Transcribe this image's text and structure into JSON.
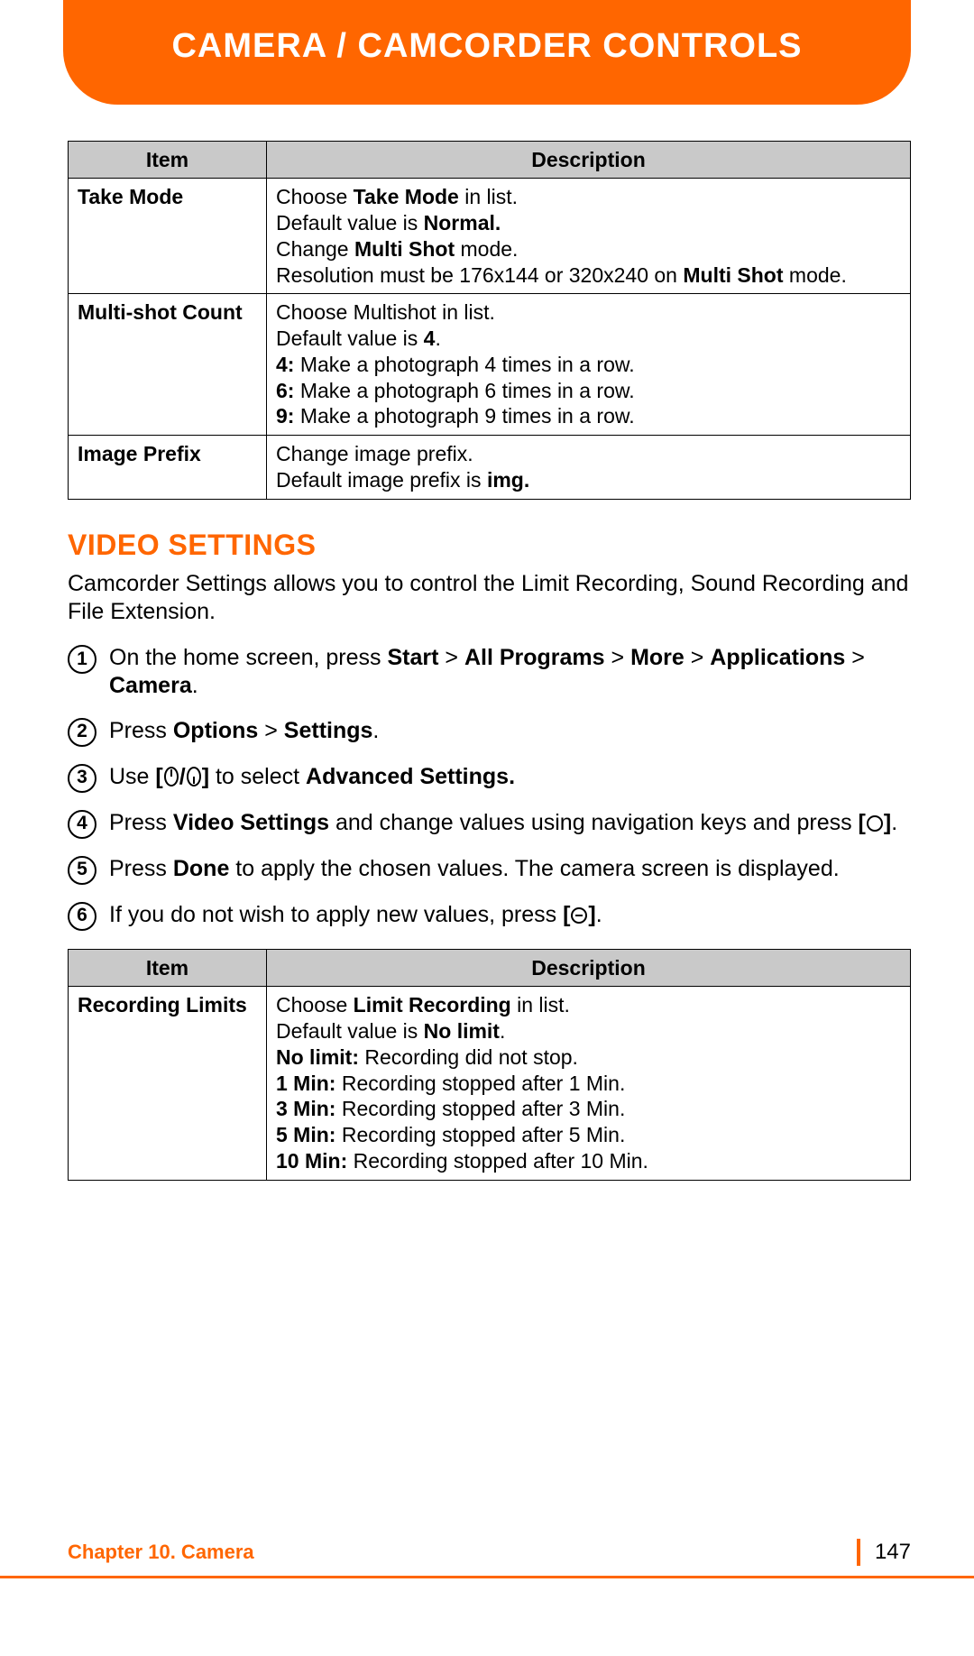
{
  "header": {
    "title": "CAMERA / CAMCORDER CONTROLS"
  },
  "table1": {
    "head_item": "Item",
    "head_desc": "Description",
    "rows": [
      {
        "item": "Take Mode",
        "desc_html": "Choose <b>Take Mode</b> in list.<br>Default value is <b>Normal.</b><br>Change <b>Multi Shot</b> mode.<br>Resolution must be 176x144 or 320x240 on <b>Multi Shot</b> mode."
      },
      {
        "item": "Multi-shot Count",
        "desc_html": "Choose Multishot in list.<br>Default value is <b>4</b>.<br><b>4:</b> Make a photograph 4 times in a row.<br><b>6:</b> Make a photograph 6 times in a row.<br><b>9:</b> Make a photograph 9 times in a row."
      },
      {
        "item": "Image Prefix",
        "desc_html": "Change image prefix.<br>Default image prefix is <b>img.</b>"
      }
    ]
  },
  "section": {
    "title": "VIDEO SETTINGS",
    "intro": "Camcorder Settings allows you to control the Limit Recording, Sound Recording and File Extension."
  },
  "steps": [
    {
      "n": "1",
      "html": "On the home screen, press <b>Start</b> &gt; <b>All Programs</b> &gt; <b>More</b> &gt; <b>Applications</b> &gt; <b>Camera</b>."
    },
    {
      "n": "2",
      "html": "Press <b>Options</b> &gt; <b>Settings</b>."
    },
    {
      "n": "3",
      "html": "Use <b>[</b><svg class='inline-icon' width='18' height='22'><ellipse cx='9' cy='11' rx='7' ry='10' fill='none' stroke='#000' stroke-width='2'/><path d='M9 3 L9 11' stroke='#000' stroke-width='2'/></svg><b>/</b><svg class='inline-icon' width='18' height='22'><ellipse cx='9' cy='11' rx='7' ry='10' fill='none' stroke='#000' stroke-width='2'/><path d='M9 11 L9 19' stroke='#000' stroke-width='2'/></svg><b>]</b> to select <b>Advanced Settings.</b>"
    },
    {
      "n": "4",
      "html": "Press <b>Video Settings</b> and change values using navigation keys and press <b>[</b><svg class='inline-icon' width='20' height='20'><circle cx='10' cy='10' r='8' fill='none' stroke='#000' stroke-width='2'/></svg><b>]</b>."
    },
    {
      "n": "5",
      "html": "Press <b>Done</b> to apply the chosen values. The camera screen is displayed."
    },
    {
      "n": "6",
      "html": "If you do not wish to apply new values, press <b>[</b><svg class='inline-icon' width='20' height='20'><circle cx='10' cy='10' r='8' fill='none' stroke='#000' stroke-width='2'/><line x1='6' y1='10' x2='14' y2='10' stroke='#000' stroke-width='2'/></svg><b>]</b>."
    }
  ],
  "table2": {
    "head_item": "Item",
    "head_desc": "Description",
    "rows": [
      {
        "item": "Recording Limits",
        "desc_html": "Choose <b>Limit Recording</b> in list.<br>Default value is <b>No limit</b>.<br><b>No limit:</b> Recording did not stop.<br><b>1 Min:</b> Recording stopped after 1 Min.<br><b>3 Min:</b> Recording stopped after 3 Min.<br><b>5 Min:</b> Recording stopped after 5 Min.<br><b>10 Min:</b> Recording stopped after 10 Min."
      }
    ]
  },
  "footer": {
    "chapter": "Chapter 10. Camera",
    "page": "147"
  }
}
